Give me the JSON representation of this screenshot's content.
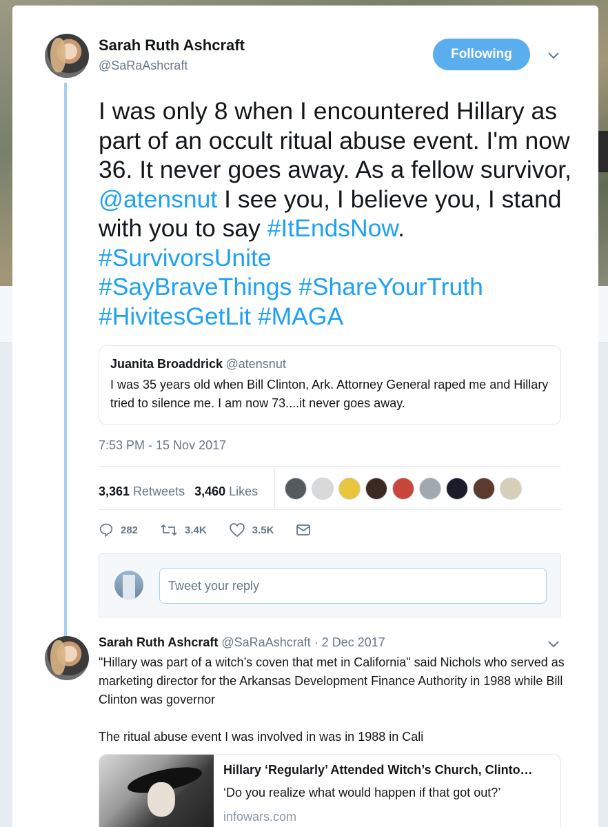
{
  "main_tweet": {
    "author_name": "Sarah Ruth Ashcraft",
    "author_handle": "@SaRaAshcraft",
    "follow_label": "Following",
    "text_parts": {
      "p1": "I was only 8 when I encountered Hillary as part of an occult ritual abuse event. I'm now 36. It never goes away. As a fellow survivor, ",
      "mention": "@atensnut",
      "p2": " I see you, I believe you, I stand with you to say ",
      "tag1": "#ItEndsNow",
      "p3": ". ",
      "tag2": "#SurvivorsUnite",
      "tag3": "#SayBraveThings",
      "tag4": "#ShareYourTruth",
      "tag5": "#HivitesGetLit",
      "tag6": "#MAGA"
    },
    "timestamp": "7:53 PM - 15 Nov 2017",
    "retweets_count": "3,361",
    "retweets_label": "Retweets",
    "likes_count": "3,460",
    "likes_label": "Likes",
    "actions": {
      "reply_count": "282",
      "retweet_count": "3.4K",
      "like_count": "3.5K"
    }
  },
  "quoted_tweet": {
    "author_name": "Juanita Broaddrick",
    "author_handle": "@atensnut",
    "text": "I was 35 years old when Bill Clinton, Ark. Attorney General raped me and Hillary tried to silence me.  I am now 73....it never goes away."
  },
  "reply_box": {
    "placeholder": "Tweet your reply"
  },
  "reply_tweet": {
    "author_name": "Sarah Ruth Ashcraft",
    "author_handle": "@SaRaAshcraft",
    "date": "· 2 Dec 2017",
    "text1": "\"Hillary was part of a witch’s coven that met in California\" said Nichols who served as marketing director for the Arkansas Development Finance Authority in 1988 while Bill Clinton was governor",
    "text2": "The ritual abuse event I was involved in was in 1988 in Cali",
    "link_card": {
      "title": "Hillary ‘Regularly’ Attended Witch’s Church, Clinto…",
      "description": "‘Do you realize what would happen if that got out?’",
      "domain": "infowars.com"
    }
  },
  "colors": {
    "accent": "#1da1f2",
    "follow_button": "#5aaeee",
    "thread_line": "#a5d0f0",
    "secondary_text": "#657786"
  },
  "liker_colors": [
    "#555a5e",
    "#d9d9d9",
    "#e8c53a",
    "#3a2a22",
    "#c9463a",
    "#a0a8b0",
    "#1b1b2a",
    "#5b3b2b",
    "#d8cfb8"
  ]
}
